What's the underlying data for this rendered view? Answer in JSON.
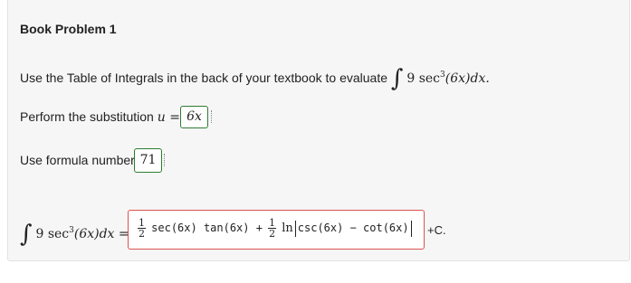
{
  "problem": {
    "title": "Book Problem 1",
    "instruction": "Use the Table of Integrals in the back of your textbook to evaluate",
    "integrand_coef": "9",
    "func": "sec",
    "power": "3",
    "arg": "(6x)dx.",
    "substitution_label": "Perform the substitution",
    "sub_var": "u =",
    "sub_answer": "6x",
    "formula_label": "Use formula number",
    "formula_answer": "71"
  },
  "result": {
    "lhs_coef": "9",
    "lhs_func": "sec",
    "lhs_power": "3",
    "lhs_arg": "(6x)dx",
    "equals": "=",
    "frac1_num": "1",
    "frac1_den": "2",
    "term1": "sec(6x) tan(6x) +",
    "frac2_num": "1",
    "frac2_den": "2",
    "ln": "ln",
    "term2": "csc(6x) − cot(6x)",
    "plus_c": "+C."
  },
  "colors": {
    "correct_border": "#2e7d32",
    "incorrect_border": "#d9534f",
    "panel_bg": "#f6f6f6"
  }
}
